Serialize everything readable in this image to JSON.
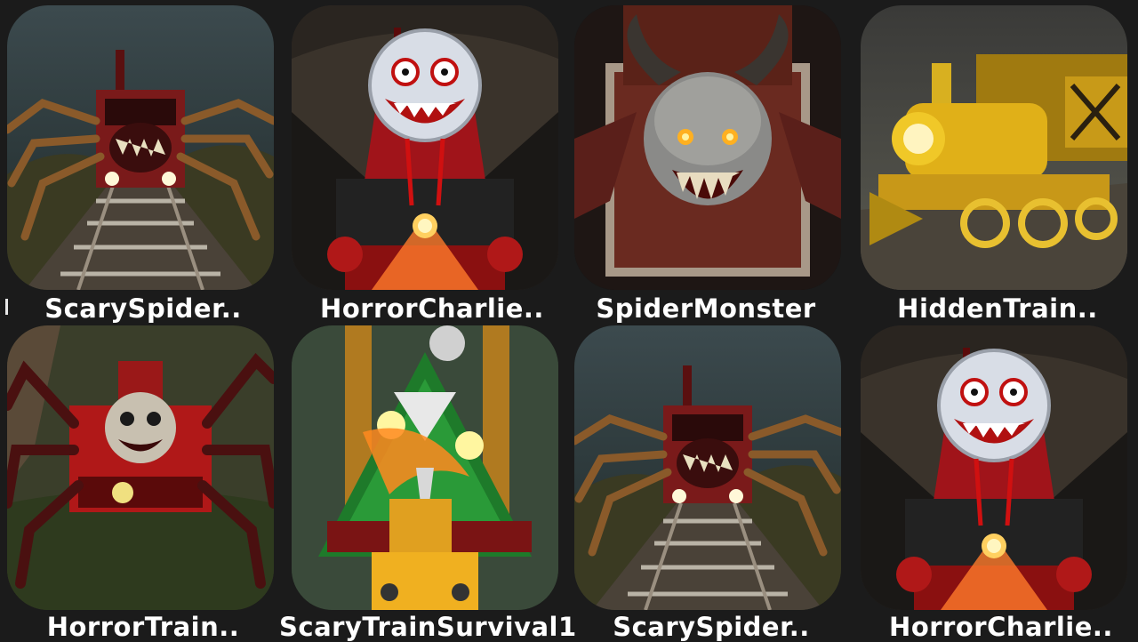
{
  "apps": [
    {
      "title": "ScarySpider..",
      "icon": "spider-train-icon"
    },
    {
      "title": "HorrorCharlie..",
      "icon": "charlie-train-icon"
    },
    {
      "title": "SpiderMonster",
      "icon": "spider-monster-icon"
    },
    {
      "title": "HiddenTrain..",
      "icon": "golden-train-icon"
    },
    {
      "title": "HorrorTrain..",
      "icon": "horror-train-icon"
    },
    {
      "title": "ScaryTrainSurvival1",
      "icon": "christmas-train-icon"
    },
    {
      "title": "ScarySpider..",
      "icon": "spider-train-icon"
    },
    {
      "title": "HorrorCharlie..",
      "icon": "charlie-train-icon"
    }
  ],
  "colors": {
    "background": "#1b1b1b",
    "label": "#ffffff"
  }
}
